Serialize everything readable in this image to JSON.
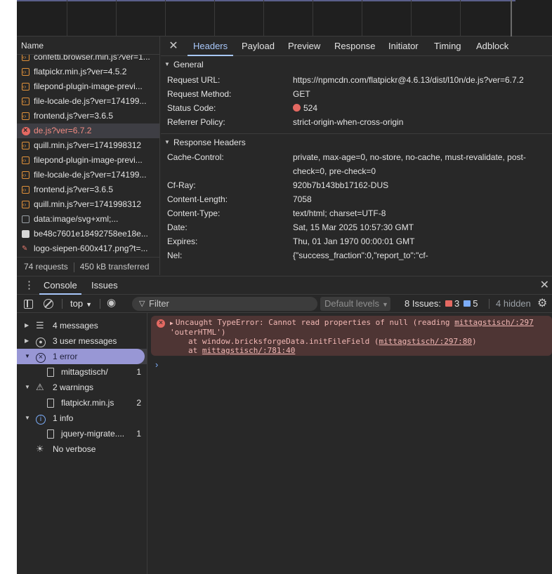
{
  "network": {
    "name_header": "Name",
    "requests": [
      {
        "name": "confetti.browser.min.js?ver=1...",
        "type": "script"
      },
      {
        "name": "flatpickr.min.js?ver=4.5.2",
        "type": "script"
      },
      {
        "name": "filepond-plugin-image-previ...",
        "type": "script"
      },
      {
        "name": "file-locale-de.js?ver=174199...",
        "type": "script"
      },
      {
        "name": "frontend.js?ver=3.6.5",
        "type": "script"
      },
      {
        "name": "de.js?ver=6.7.2",
        "type": "error"
      },
      {
        "name": "quill.min.js?ver=1741998312",
        "type": "script"
      },
      {
        "name": "filepond-plugin-image-previ...",
        "type": "script"
      },
      {
        "name": "file-locale-de.js?ver=174199...",
        "type": "script"
      },
      {
        "name": "frontend.js?ver=3.6.5",
        "type": "script"
      },
      {
        "name": "quill.min.js?ver=1741998312",
        "type": "script"
      },
      {
        "name": "data:image/svg+xml;...",
        "type": "image"
      },
      {
        "name": "be48c7601e18492758ee18e...",
        "type": "document"
      },
      {
        "name": "logo-siepen-600x417.png?t=...",
        "type": "logo"
      }
    ],
    "footer": {
      "requests": "74 requests",
      "transferred": "450 kB transferred"
    }
  },
  "details": {
    "tabs": [
      "Headers",
      "Payload",
      "Preview",
      "Response",
      "Initiator",
      "Timing",
      "Adblock"
    ],
    "active_tab": "Headers",
    "general": {
      "title": "General",
      "rows": [
        {
          "key": "Request URL:",
          "value": "https://npmcdn.com/flatpickr@4.6.13/dist/l10n/de.js?ver=6.7.2"
        },
        {
          "key": "Request Method:",
          "value": "GET"
        },
        {
          "key": "Status Code:",
          "value": "524"
        },
        {
          "key": "Referrer Policy:",
          "value": "strict-origin-when-cross-origin"
        }
      ]
    },
    "response_headers": {
      "title": "Response Headers",
      "rows": [
        {
          "key": "Cache-Control:",
          "value": "private, max-age=0, no-store, no-cache, must-revalidate, post-check=0, pre-check=0"
        },
        {
          "key": "Cf-Ray:",
          "value": "920b7b143bb17162-DUS"
        },
        {
          "key": "Content-Length:",
          "value": "7058"
        },
        {
          "key": "Content-Type:",
          "value": "text/html; charset=UTF-8"
        },
        {
          "key": "Date:",
          "value": "Sat, 15 Mar 2025 10:57:30 GMT"
        },
        {
          "key": "Expires:",
          "value": "Thu, 01 Jan 1970 00:00:01 GMT"
        },
        {
          "key": "Nel:",
          "value": "{\"success_fraction\":0,\"report_to\":\"cf-"
        }
      ]
    }
  },
  "drawer": {
    "tabs": [
      "Console",
      "Issues"
    ],
    "active_tab": "Console"
  },
  "console_toolbar": {
    "context": "top",
    "filter_placeholder": "Filter",
    "levels": "Default levels",
    "issues_label": "8 Issues:",
    "issues_errors": "3",
    "issues_info": "5",
    "hidden": "4 hidden"
  },
  "console_sidebar": {
    "items": [
      {
        "label": "4 messages",
        "expanded": false
      },
      {
        "label": "3 user messages",
        "expanded": false
      },
      {
        "label": "1 error",
        "expanded": true,
        "selected": true
      },
      {
        "label": "mittagstisch/",
        "count": "1",
        "sub": true
      },
      {
        "label": "2 warnings",
        "expanded": true
      },
      {
        "label": "flatpickr.min.js",
        "count": "2",
        "sub": true
      },
      {
        "label": "1 info",
        "expanded": true
      },
      {
        "label": "jquery-migrate....",
        "count": "1",
        "sub": true
      },
      {
        "label": "No verbose",
        "expanded": false
      }
    ]
  },
  "console_output": {
    "error": {
      "message": "Uncaught TypeError: Cannot read properties of null (reading",
      "source_link": "mittagstisch/:297",
      "message_cont": "'outerHTML')",
      "stack1_prefix": "at window.bricksforgeData.initFileField (",
      "stack1_link": "mittagstisch/:297:80",
      "stack1_suffix": ")",
      "stack2_prefix": "at ",
      "stack2_link": "mittagstisch/:781:40"
    },
    "prompt": "›"
  },
  "colors": {
    "panel_bg": "#282828",
    "accent": "#a8c7fa",
    "error": "#e46962",
    "error_bg": "#4e3534",
    "selected_filter": "#a8a7ef"
  }
}
